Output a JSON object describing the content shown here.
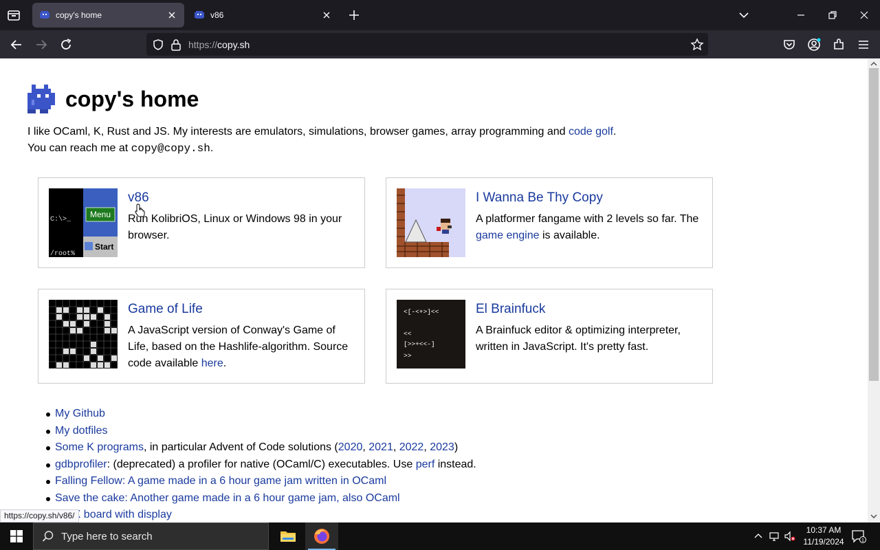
{
  "browser": {
    "tabs": [
      {
        "title": "copy's home",
        "active": true
      },
      {
        "title": "v86",
        "active": false
      }
    ],
    "url": {
      "scheme": "https://",
      "host": "copy.sh"
    }
  },
  "page": {
    "title": "copy's home",
    "intro": {
      "line1": "I like OCaml, K, Rust and JS. My interests are emulators, simulations, browser games, array programming and ",
      "code_golf": "code golf",
      "line1_end": ".",
      "line2_pre": "You can reach me at ",
      "email": "copy@copy.sh",
      "line2_end": "."
    },
    "cards": [
      {
        "title": "v86",
        "desc": "Run KolibriOS, Linux or Windows 98 in your browser.",
        "thumb": {
          "prompt": "C:\\>_",
          "menu": "Menu",
          "start": "Start",
          "root": "/root%"
        }
      },
      {
        "title": "I Wanna Be Thy Copy",
        "desc_pre": "A platformer fangame with 2 levels so far. The ",
        "link": "game engine",
        "desc_post": " is available."
      },
      {
        "title": "Game of Life",
        "desc_pre": "A JavaScript version of Conway's Game of Life, based on the Hashlife-algorithm. Source code available ",
        "link": "here",
        "desc_post": "."
      },
      {
        "title": "El Brainfuck",
        "desc": "A Brainfuck editor & optimizing interpreter, written in JavaScript. It's pretty fast.",
        "thumb_lines": [
          "<[-<+>]<<",
          "",
          "<<",
          "[>>+<<-]",
          ">>"
        ]
      }
    ],
    "links": {
      "github": "My Github",
      "dotfiles": "My dotfiles",
      "k_link": "Some K programs",
      "k_text": ", in particular Advent of Code solutions (",
      "y2020": "2020",
      "y2021": "2021",
      "y2022": "2022",
      "y2023": "2023",
      "k_close": ")",
      "sep": ", ",
      "gdb_link": "gdbprofiler",
      "gdb_text": ": (deprecated) a profiler for native (OCaml/C) executables. Use ",
      "perf": "perf",
      "gdb_end": " instead.",
      "falling": "Falling Fellow: A game made in a 6 hour game jam written in OCaml",
      "cake": "Save the cake: Another game made in a 6 hour game jam, also OCaml",
      "board": "...LIX board with display"
    },
    "status_url": "https://copy.sh/v86/"
  },
  "taskbar": {
    "search_placeholder": "Type here to search",
    "time": "10:37 AM",
    "date": "11/19/2024",
    "notif_count": "1"
  },
  "colors": {
    "link": "#1a3a9e",
    "accent": "#76b9ed"
  }
}
